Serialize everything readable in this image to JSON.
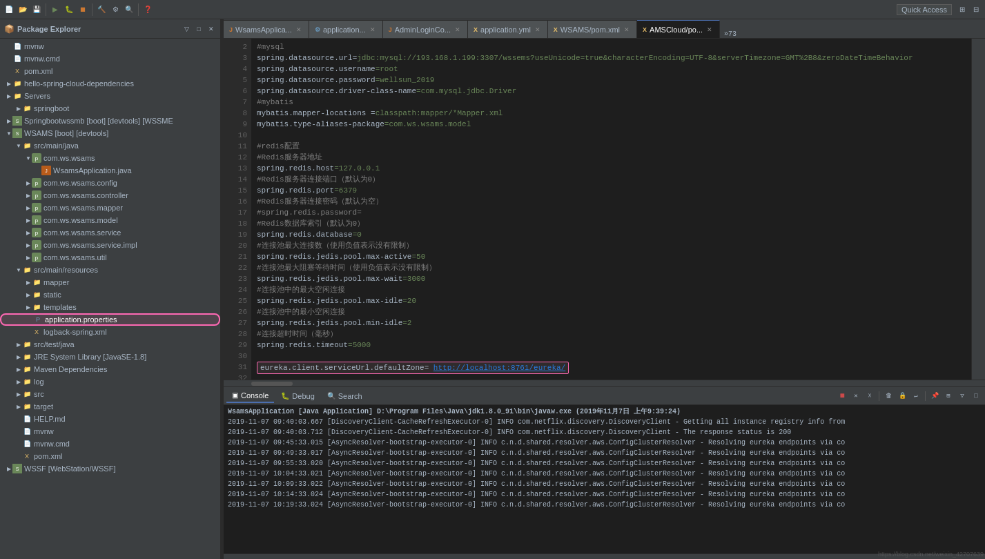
{
  "toolbar": {
    "quick_access_label": "Quick Access",
    "buttons": [
      "⬛",
      "▶",
      "⏹",
      "🔧",
      "⚙",
      "🔍"
    ]
  },
  "left_panel": {
    "title": "Package Explorer",
    "tree": [
      {
        "id": "mvnw",
        "label": "mvnw",
        "indent": 0,
        "type": "file",
        "toggle": ""
      },
      {
        "id": "mvnw-cmd",
        "label": "mvnw.cmd",
        "indent": 0,
        "type": "file",
        "toggle": ""
      },
      {
        "id": "pom-xml",
        "label": "pom.xml",
        "indent": 0,
        "type": "xml",
        "toggle": ""
      },
      {
        "id": "hello-spring",
        "label": "hello-spring-cloud-dependencies",
        "indent": 0,
        "type": "folder",
        "toggle": "▶"
      },
      {
        "id": "servers",
        "label": "Servers",
        "indent": 0,
        "type": "folder",
        "toggle": "▶"
      },
      {
        "id": "springboot",
        "label": "springboot",
        "indent": 1,
        "type": "folder",
        "toggle": "▶"
      },
      {
        "id": "springbootwssmb",
        "label": "Springbootwssmb [boot] [devtools] [WSSME",
        "indent": 0,
        "type": "spring",
        "toggle": "▶"
      },
      {
        "id": "wsams",
        "label": "WSAMS [boot] [devtools]",
        "indent": 0,
        "type": "spring",
        "toggle": "▼",
        "expanded": true
      },
      {
        "id": "src-main-java",
        "label": "src/main/java",
        "indent": 1,
        "type": "folder",
        "toggle": "▼",
        "expanded": true
      },
      {
        "id": "com-ws-wsams",
        "label": "com.ws.wsams",
        "indent": 2,
        "type": "package",
        "toggle": "▼",
        "expanded": true
      },
      {
        "id": "wsams-app",
        "label": "WsamsApplication.java",
        "indent": 3,
        "type": "java",
        "toggle": ""
      },
      {
        "id": "config",
        "label": "com.ws.wsams.config",
        "indent": 2,
        "type": "package",
        "toggle": "▶"
      },
      {
        "id": "controller",
        "label": "com.ws.wsams.controller",
        "indent": 2,
        "type": "package",
        "toggle": "▶"
      },
      {
        "id": "mapper",
        "label": "com.ws.wsams.mapper",
        "indent": 2,
        "type": "package",
        "toggle": "▶"
      },
      {
        "id": "model",
        "label": "com.ws.wsams.model",
        "indent": 2,
        "type": "package",
        "toggle": "▶"
      },
      {
        "id": "service",
        "label": "com.ws.wsams.service",
        "indent": 2,
        "type": "package",
        "toggle": "▶"
      },
      {
        "id": "service-impl",
        "label": "com.ws.wsams.service.impl",
        "indent": 2,
        "type": "package",
        "toggle": "▶"
      },
      {
        "id": "util",
        "label": "com.ws.wsams.util",
        "indent": 2,
        "type": "package",
        "toggle": "▶"
      },
      {
        "id": "src-main-resources",
        "label": "src/main/resources",
        "indent": 1,
        "type": "folder",
        "toggle": "▼",
        "expanded": true
      },
      {
        "id": "mapper-folder",
        "label": "mapper",
        "indent": 2,
        "type": "folder",
        "toggle": "▶"
      },
      {
        "id": "static-folder",
        "label": "static",
        "indent": 2,
        "type": "folder",
        "toggle": "▶"
      },
      {
        "id": "templates-folder",
        "label": "templates",
        "indent": 2,
        "type": "folder",
        "toggle": "▶"
      },
      {
        "id": "application-props",
        "label": "application.properties",
        "indent": 2,
        "type": "props",
        "toggle": "",
        "highlighted": true
      },
      {
        "id": "logback",
        "label": "logback-spring.xml",
        "indent": 2,
        "type": "xml",
        "toggle": ""
      },
      {
        "id": "src-test-java",
        "label": "src/test/java",
        "indent": 1,
        "type": "folder",
        "toggle": "▶"
      },
      {
        "id": "jre",
        "label": "JRE System Library [JavaSE-1.8]",
        "indent": 1,
        "type": "folder",
        "toggle": "▶"
      },
      {
        "id": "maven-deps",
        "label": "Maven Dependencies",
        "indent": 1,
        "type": "folder",
        "toggle": "▶"
      },
      {
        "id": "log-folder",
        "label": "log",
        "indent": 1,
        "type": "folder",
        "toggle": "▶"
      },
      {
        "id": "src-folder",
        "label": "src",
        "indent": 1,
        "type": "folder",
        "toggle": "▶"
      },
      {
        "id": "target-folder",
        "label": "target",
        "indent": 1,
        "type": "folder",
        "toggle": "▶"
      },
      {
        "id": "help-md",
        "label": "HELP.md",
        "indent": 1,
        "type": "file",
        "toggle": ""
      },
      {
        "id": "mvnw2",
        "label": "mvnw",
        "indent": 1,
        "type": "file",
        "toggle": ""
      },
      {
        "id": "mvnw-cmd2",
        "label": "mvnw.cmd",
        "indent": 1,
        "type": "file",
        "toggle": ""
      },
      {
        "id": "pom-xml2",
        "label": "pom.xml",
        "indent": 1,
        "type": "xml",
        "toggle": ""
      },
      {
        "id": "wssf",
        "label": "WSSF [WebStation/WSSF]",
        "indent": 0,
        "type": "spring",
        "toggle": "▶"
      }
    ]
  },
  "editor": {
    "tabs": [
      {
        "id": "wsams-app-tab",
        "label": "WsamsApplica...",
        "active": false,
        "icon": "java",
        "closable": true
      },
      {
        "id": "application-tab",
        "label": "application...",
        "active": false,
        "icon": "props",
        "closable": true
      },
      {
        "id": "adminlogin-tab",
        "label": "AdminLoginCo...",
        "active": false,
        "icon": "java",
        "closable": true
      },
      {
        "id": "application-yml",
        "label": "application.yml",
        "active": false,
        "icon": "xml",
        "closable": true
      },
      {
        "id": "wsams-pom",
        "label": "WSAMS/pom.xml",
        "active": false,
        "icon": "xml",
        "closable": true
      },
      {
        "id": "amscloud-po",
        "label": "AMSCloud/po...",
        "active": true,
        "icon": "xml",
        "closable": true
      }
    ],
    "tab_more": "»73",
    "code_lines": [
      {
        "num": "2",
        "content": "#mysql",
        "type": "comment"
      },
      {
        "num": "3",
        "content": "spring.datasource.url=jdbc:mysql://193.168.1.199:3307/wssems?useUnicode=true&characterEncoding=UTF-8&serverTimezone=GMT%2B8&zeroDateTimeBehavior",
        "type": "normal"
      },
      {
        "num": "4",
        "content": "spring.datasource.username=root",
        "type": "normal"
      },
      {
        "num": "5",
        "content": "spring.datasource.password=wellsun_2019",
        "type": "normal"
      },
      {
        "num": "6",
        "content": "spring.datasource.driver-class-name=com.mysql.jdbc.Driver",
        "type": "normal"
      },
      {
        "num": "7",
        "content": "#mybatis",
        "type": "comment"
      },
      {
        "num": "8",
        "content": "mybatis.mapper-locations =classpath:mapper/*Mapper.xml",
        "type": "normal"
      },
      {
        "num": "9",
        "content": "mybatis.type-aliases-package=com.ws.wsams.model",
        "type": "normal"
      },
      {
        "num": "10",
        "content": "",
        "type": "normal"
      },
      {
        "num": "11",
        "content": "#redis配置",
        "type": "comment"
      },
      {
        "num": "12",
        "content": "#Redis服务器地址",
        "type": "comment"
      },
      {
        "num": "13",
        "content": "spring.redis.host=127.0.0.1",
        "type": "normal"
      },
      {
        "num": "14",
        "content": "#Redis服务器连接端口（默认为0）",
        "type": "comment"
      },
      {
        "num": "15",
        "content": "spring.redis.port=6379",
        "type": "normal"
      },
      {
        "num": "16",
        "content": "#Redis服务器连接密码（默认为空）",
        "type": "comment"
      },
      {
        "num": "17",
        "content": "#spring.redis.password=",
        "type": "comment"
      },
      {
        "num": "18",
        "content": "#Redis数据库索引（默认为0）",
        "type": "comment"
      },
      {
        "num": "19",
        "content": "spring.redis.database=0",
        "type": "normal"
      },
      {
        "num": "20",
        "content": "#连接池最大连接数（使用负值表示没有限制）",
        "type": "comment"
      },
      {
        "num": "21",
        "content": "spring.redis.jedis.pool.max-active=50",
        "type": "normal"
      },
      {
        "num": "22",
        "content": "#连接池最大阻塞等待时间（使用负值表示没有限制）",
        "type": "comment"
      },
      {
        "num": "23",
        "content": "spring.redis.jedis.pool.max-wait=3000",
        "type": "normal"
      },
      {
        "num": "24",
        "content": "#连接池中的最大空闲连接",
        "type": "comment"
      },
      {
        "num": "25",
        "content": "spring.redis.jedis.pool.max-idle=20",
        "type": "normal"
      },
      {
        "num": "26",
        "content": "#连接池中的最小空闲连接",
        "type": "comment"
      },
      {
        "num": "27",
        "content": "spring.redis.jedis.pool.min-idle=2",
        "type": "normal"
      },
      {
        "num": "28",
        "content": "#连接超时时间（毫秒）",
        "type": "comment"
      },
      {
        "num": "29",
        "content": "spring.redis.timeout=5000",
        "type": "normal"
      },
      {
        "num": "30",
        "content": "",
        "type": "normal"
      },
      {
        "num": "31",
        "content": "eureka.client.serviceUrl.defaultZone= http://localhost:8761/eureka/",
        "type": "highlighted"
      },
      {
        "num": "32",
        "content": "",
        "type": "normal"
      }
    ]
  },
  "console": {
    "tabs": [
      {
        "id": "console-tab",
        "label": "Console",
        "active": true,
        "icon": "▣"
      },
      {
        "id": "debug-tab",
        "label": "Debug",
        "active": false,
        "icon": "🐛"
      },
      {
        "id": "search-tab",
        "label": "Search",
        "active": false,
        "icon": "🔍"
      }
    ],
    "title_line": "WsamsApplication [Java Application] D:\\Program Files\\Java\\jdk1.8.0_91\\bin\\javaw.exe (2019年11月7日 上午9:39:24)",
    "log_lines": [
      "2019-11-07 09:40:03.667 [DiscoveryClient-CacheRefreshExecutor-0] INFO  com.netflix.discovery.DiscoveryClient - Getting all instance registry info from",
      "2019-11-07 09:40:03.712 [DiscoveryClient-CacheRefreshExecutor-0] INFO  com.netflix.discovery.DiscoveryClient - The response status is 200",
      "2019-11-07 09:45:33.015 [AsyncResolver-bootstrap-executor-0] INFO  c.n.d.shared.resolver.aws.ConfigClusterResolver - Resolving eureka endpoints via co",
      "2019-11-07 09:49:33.017 [AsyncResolver-bootstrap-executor-0] INFO  c.n.d.shared.resolver.aws.ConfigClusterResolver - Resolving eureka endpoints via co",
      "2019-11-07 09:55:33.020 [AsyncResolver-bootstrap-executor-0] INFO  c.n.d.shared.resolver.aws.ConfigClusterResolver - Resolving eureka endpoints via co",
      "2019-11-07 10:04:33.021 [AsyncResolver-bootstrap-executor-0] INFO  c.n.d.shared.resolver.aws.ConfigClusterResolver - Resolving eureka endpoints via co",
      "2019-11-07 10:09:33.022 [AsyncResolver-bootstrap-executor-0] INFO  c.n.d.shared.resolver.aws.ConfigClusterResolver - Resolving eureka endpoints via co",
      "2019-11-07 10:14:33.024 [AsyncResolver-bootstrap-executor-0] INFO  c.n.d.shared.resolver.aws.ConfigClusterResolver - Resolving eureka endpoints via co",
      "2019-11-07 10:19:33.024 [AsyncResolver-bootstrap-executor-0] INFO  c.n.d.shared.resolver.aws.ConfigClusterResolver - Resolving eureka endpoints via co"
    ]
  },
  "watermark": "https://blog.csdn.net/weixin_42707639"
}
